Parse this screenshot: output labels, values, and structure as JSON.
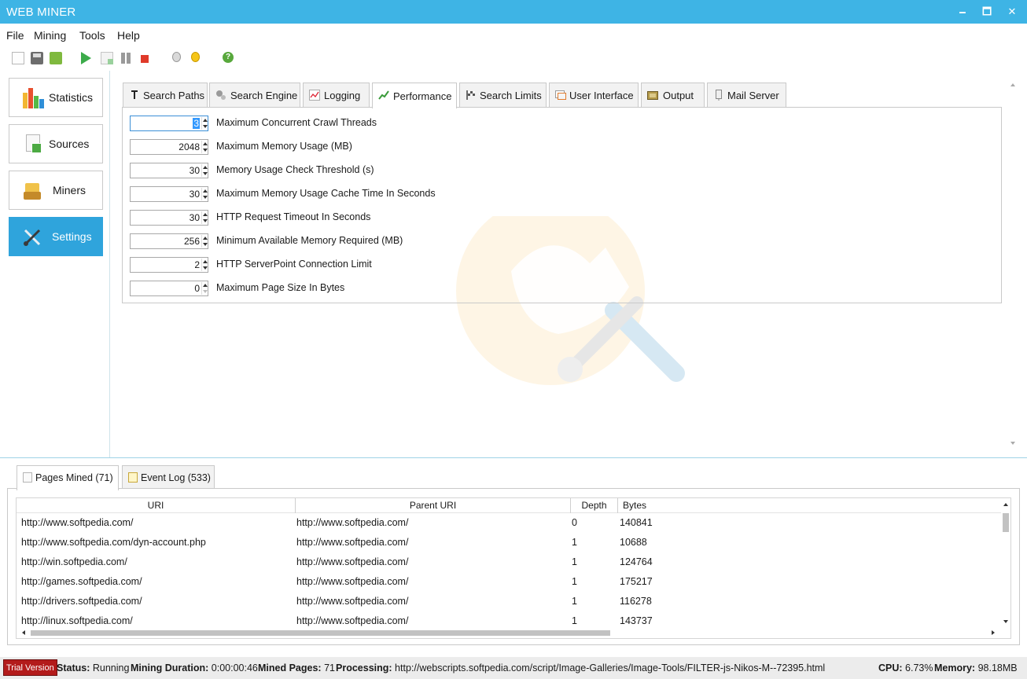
{
  "window": {
    "title": "WEB MINER",
    "minimize": "🗕",
    "maximize": "🗖",
    "close": "✕"
  },
  "menu": [
    "File",
    "Mining",
    "Tools",
    "Help"
  ],
  "toolbar": {
    "help_glyph": "?"
  },
  "sidebar": {
    "items": [
      {
        "label": "Statistics",
        "icon": "bar-chart-icon"
      },
      {
        "label": "Sources",
        "icon": "document-icon"
      },
      {
        "label": "Miners",
        "icon": "miners-icon"
      },
      {
        "label": "Settings",
        "icon": "tools-icon",
        "active": true
      }
    ]
  },
  "settings_tabs": [
    {
      "label": "Search Paths",
      "icon": "text-cursor-icon"
    },
    {
      "label": "Search Engine",
      "icon": "gears-icon"
    },
    {
      "label": "Logging",
      "icon": "chart-icon"
    },
    {
      "label": "Performance",
      "icon": "performance-icon",
      "active": true
    },
    {
      "label": "Search Limits",
      "icon": "flag-icon"
    },
    {
      "label": "User Interface",
      "icon": "window-icon"
    },
    {
      "label": "Output",
      "icon": "output-icon"
    },
    {
      "label": "Mail Server",
      "icon": "mail-server-icon"
    }
  ],
  "performance": [
    {
      "value": "3",
      "label": "Maximum Concurrent Crawl Threads"
    },
    {
      "value": "2048",
      "label": "Maximum Memory Usage (MB)"
    },
    {
      "value": "30",
      "label": "Memory Usage Check Threshold (s)"
    },
    {
      "value": "30",
      "label": "Maximum Memory Usage Cache Time In Seconds"
    },
    {
      "value": "30",
      "label": "HTTP Request Timeout In Seconds"
    },
    {
      "value": "256",
      "label": "Minimum Available Memory Required (MB)"
    },
    {
      "value": "2",
      "label": "HTTP ServerPoint Connection Limit"
    },
    {
      "value": "0",
      "label": "Maximum Page Size In Bytes"
    }
  ],
  "bottom_tabs": [
    {
      "label": "Pages Mined (71)",
      "active": true
    },
    {
      "label": "Event Log (533)"
    }
  ],
  "grid": {
    "columns": [
      "URI",
      "Parent URI",
      "Depth",
      "Bytes"
    ],
    "rows": [
      [
        "http://www.softpedia.com/",
        "http://www.softpedia.com/",
        "0",
        "140841"
      ],
      [
        "http://www.softpedia.com/dyn-account.php",
        "http://www.softpedia.com/",
        "1",
        "10688"
      ],
      [
        "http://win.softpedia.com/",
        "http://www.softpedia.com/",
        "1",
        "124764"
      ],
      [
        "http://games.softpedia.com/",
        "http://www.softpedia.com/",
        "1",
        "175217"
      ],
      [
        "http://drivers.softpedia.com/",
        "http://www.softpedia.com/",
        "1",
        "116278"
      ],
      [
        "http://linux.softpedia.com/",
        "http://www.softpedia.com/",
        "1",
        "143737"
      ]
    ]
  },
  "status": {
    "trial": "Trial Version",
    "status_label": "Status:",
    "status_value": "Running",
    "duration_label": "Mining Duration:",
    "duration_value": "0:00:00:46",
    "pages_label": "Mined Pages:",
    "pages_value": "71",
    "processing_label": "Processing:",
    "processing_value": "http://webscripts.softpedia.com/script/Image-Galleries/Image-Tools/FILTER-js-Nikos-M--72395.html",
    "cpu_label": "CPU:",
    "cpu_value": "6.73%",
    "memory_label": "Memory:",
    "memory_value": "98.18MB"
  },
  "colors": {
    "titlebar": "#3eb4e5",
    "accent": "#2fa4dc",
    "trial": "#b31b1b"
  }
}
